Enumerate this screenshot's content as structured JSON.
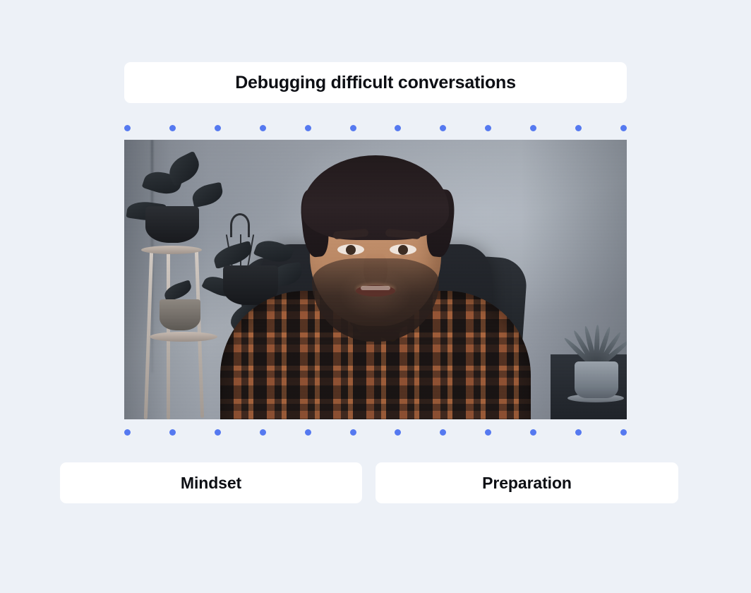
{
  "page": {
    "background_color": "#edf1f7",
    "accent_dot_color": "#5579f0",
    "card_color": "#ffffff",
    "text_color": "#0d0f14"
  },
  "header": {
    "title": "Debugging difficult conversations"
  },
  "dots": {
    "top_count": 12,
    "bottom_count": 12,
    "color": "#5579f0"
  },
  "video": {
    "alt": "Man with dark hair and beard wearing an orange and black plaid shirt, seated in a black office chair, speaking to camera. Hanging plants on a white plant stand to his left and a potted aloe on a dark shelf to his right, against a grey wall."
  },
  "buttons": [
    {
      "label": "Mindset"
    },
    {
      "label": "Preparation"
    }
  ]
}
